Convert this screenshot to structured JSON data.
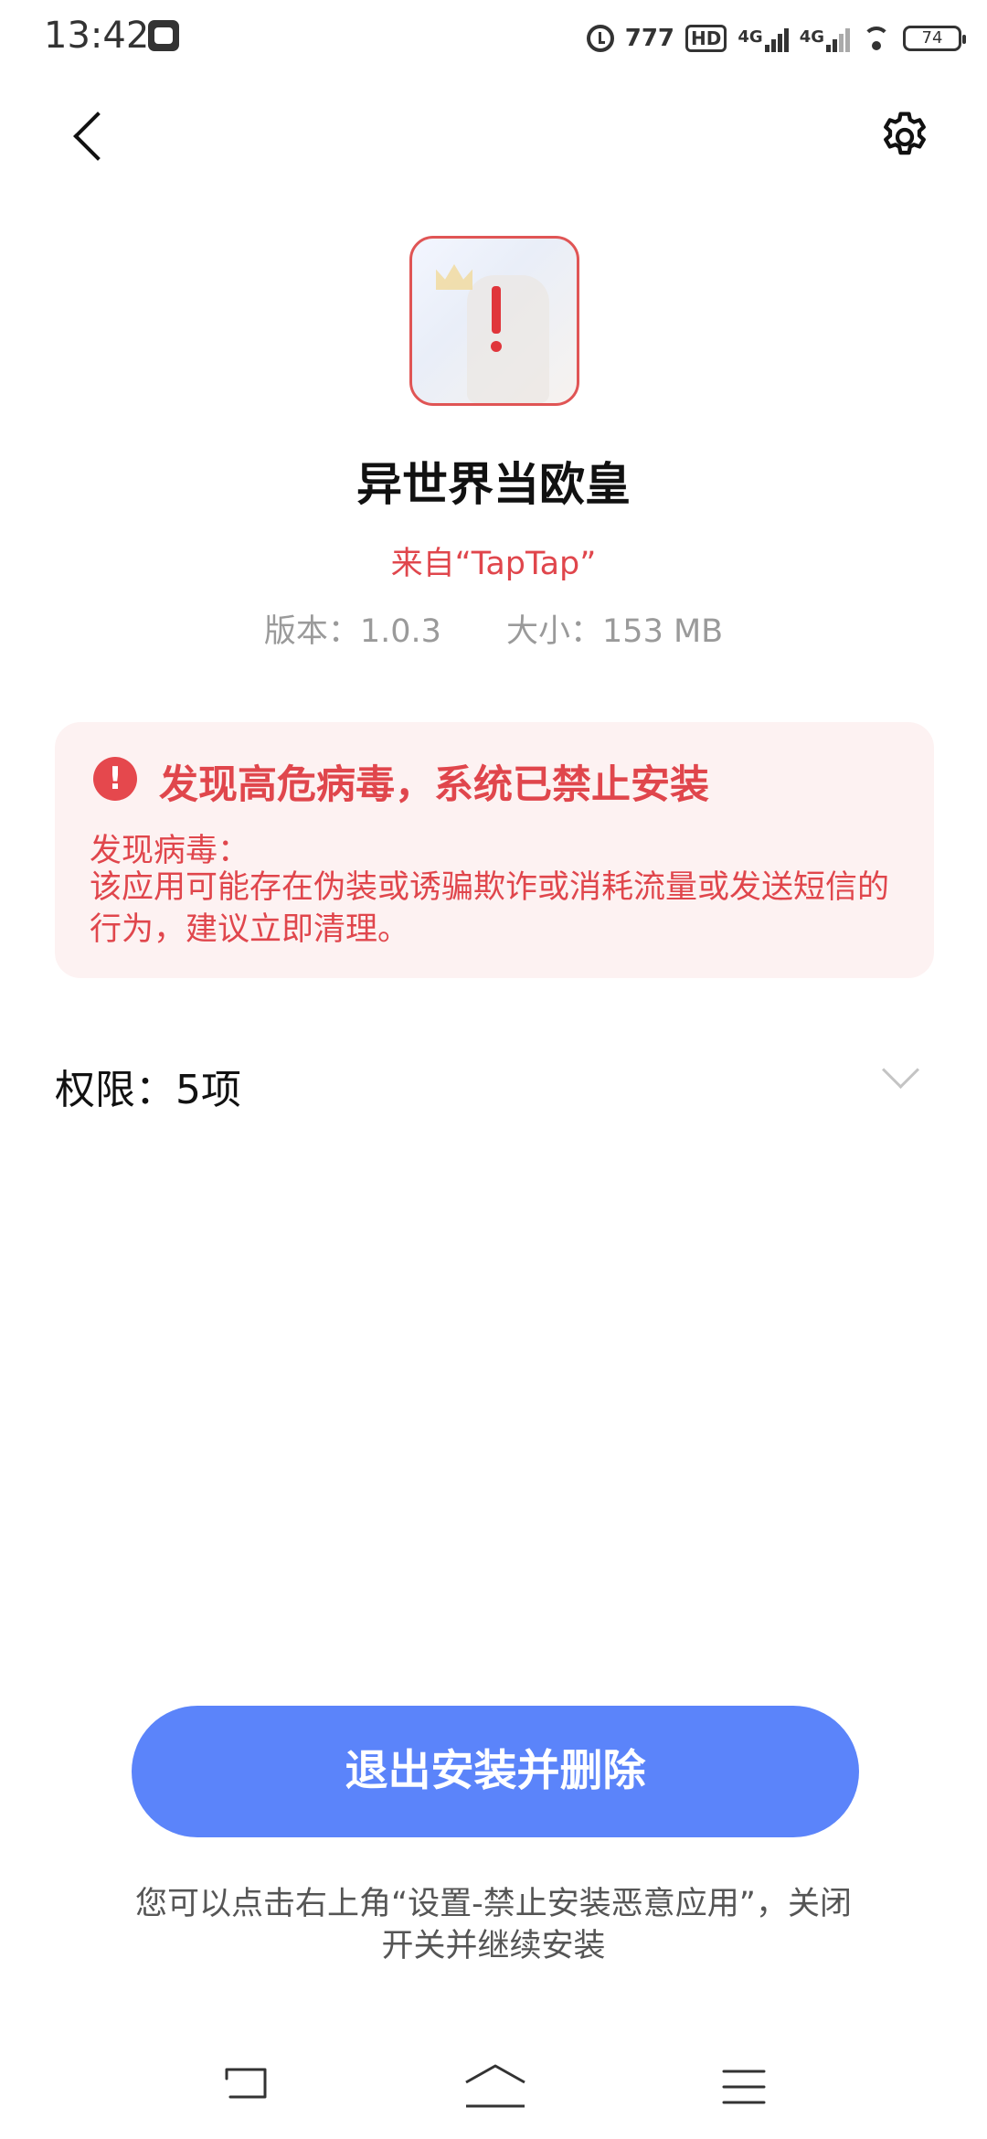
{
  "status_bar": {
    "time": "13:42",
    "battery": "74",
    "network_label": "4G",
    "hd_label": "HD"
  },
  "nav": {
    "back_icon": "back-chevron-icon",
    "settings_icon": "gear-icon"
  },
  "app": {
    "name": "异世界当欧皇",
    "source": "来自“TapTap”",
    "version": "版本：1.0.3",
    "size": "大小：153 MB"
  },
  "warning": {
    "title": "发现高危病毒，系统已禁止安装",
    "subtitle": "发现病毒：",
    "description": "该应用可能存在伪装或诱骗欺诈或消耗流量或发送短信的行为，建议立即清理。",
    "color": "#e0464c"
  },
  "permissions": {
    "label": "权限：5项"
  },
  "actions": {
    "primary_label": "退出安装并删除",
    "primary_color": "#5b84fa",
    "hint": "您可以点击右上角“设置-禁止安装恶意应用”，关闭开关并继续安装"
  }
}
